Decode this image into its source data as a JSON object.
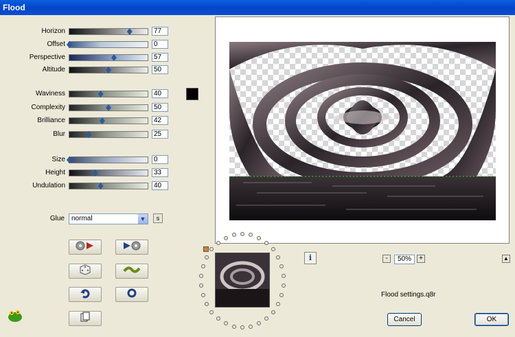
{
  "window": {
    "title": "Flood"
  },
  "sliders": [
    {
      "label": "Horizon",
      "value": "77",
      "fraction": 0.77,
      "track": "linear-gradient(90deg,#111,#888 55%,#eee)"
    },
    {
      "label": "Offset",
      "value": "0",
      "fraction": 0.0,
      "track": "linear-gradient(90deg,#3a5a8a,#b8c8d8 40%,#eef2f6)"
    },
    {
      "label": "Perspective",
      "value": "57",
      "fraction": 0.57,
      "track": "linear-gradient(90deg,#1a2a5a,#8aa0c0 55%,#e8edf3)"
    },
    {
      "label": "Altitude",
      "value": "50",
      "fraction": 0.5,
      "track": "linear-gradient(90deg,#111,#777 50%,#eee)"
    },
    {
      "label": "Waviness",
      "value": "40",
      "fraction": 0.4,
      "track": "linear-gradient(90deg,#222,#8a9288 45%,#e9ecdf)"
    },
    {
      "label": "Complexity",
      "value": "50",
      "fraction": 0.5,
      "track": "linear-gradient(90deg,#222,#8a9288 45%,#e9ecdf)"
    },
    {
      "label": "Brilliance",
      "value": "42",
      "fraction": 0.42,
      "track": "linear-gradient(90deg,#222,#8a9288 45%,#e9ecdf)"
    },
    {
      "label": "Blur",
      "value": "25",
      "fraction": 0.25,
      "track": "linear-gradient(90deg,#222,#8a9288 45%,#e9ecdf)"
    },
    {
      "label": "Size",
      "value": "0",
      "fraction": 0.0,
      "track": "linear-gradient(90deg,#3a4a6a,#9aa8bc 45%,#eef0f4)"
    },
    {
      "label": "Height",
      "value": "33",
      "fraction": 0.33,
      "track": "linear-gradient(90deg,#111,#7a7e88 45%,#e6e8ec)"
    },
    {
      "label": "Undulation",
      "value": "40",
      "fraction": 0.4,
      "track": "linear-gradient(90deg,#222,#8a9288 45%,#e9ecdf)"
    }
  ],
  "swatch_color": "#000000",
  "glue": {
    "label": "Glue",
    "value": "normal",
    "s_button": "s"
  },
  "buttons": {
    "randomize_icon": "dice-icon",
    "reset_icon": "reset-icon",
    "undo_icon": "undo-icon",
    "copy_icon": "copy-icon"
  },
  "zoom": {
    "value": "50%",
    "minus": "-",
    "plus": "+"
  },
  "settings_file": "Flood settings.q8r",
  "dialog": {
    "cancel": "Cancel",
    "ok": "OK"
  },
  "info": "i",
  "up": "▲"
}
